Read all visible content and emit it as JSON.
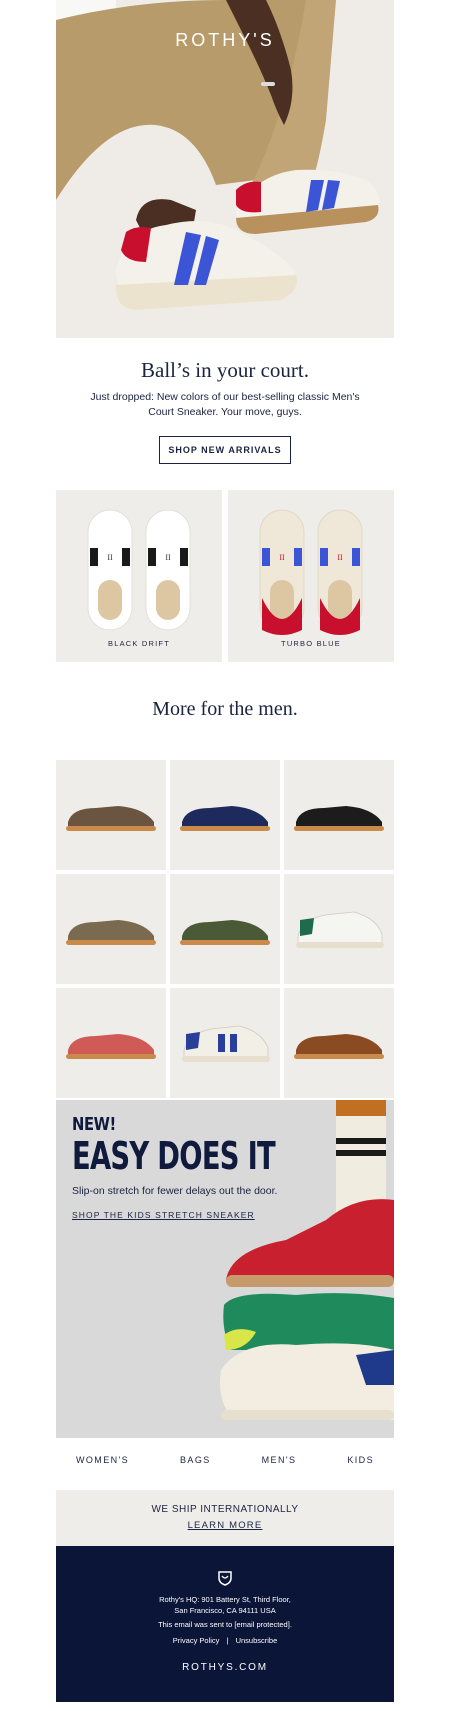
{
  "brand": {
    "logo_text": "ROTHY'S"
  },
  "hero": {
    "headline": "Ball’s in your court.",
    "subtext": "Just dropped: New colors of our best-selling classic Men's Court Sneaker. Your move, guys.",
    "cta_label": "SHOP NEW ARRIVALS"
  },
  "products": [
    {
      "label": "BLACK DRIFT"
    },
    {
      "label": "TURBO BLUE"
    }
  ],
  "more": {
    "title": "More for the men."
  },
  "grid": [
    {
      "name": "brown-driver",
      "color": "#6b5540"
    },
    {
      "name": "navy-driver",
      "color": "#1f2a5c"
    },
    {
      "name": "black-driver",
      "color": "#1c1c1c"
    },
    {
      "name": "camo-brown-driver",
      "color": "#7a6a50"
    },
    {
      "name": "camo-green-driver",
      "color": "#4b5a36"
    },
    {
      "name": "white-green-sneaker",
      "color": "#f5f5f2"
    },
    {
      "name": "red-driver",
      "color": "#d05a55"
    },
    {
      "name": "navy-stripe-sneaker",
      "color": "#f2efe6"
    },
    {
      "name": "cognac-loafer",
      "color": "#8a4a22"
    }
  ],
  "kids": {
    "kicker": "NEW!",
    "title": "EASY DOES IT",
    "subtext": "Slip-on stretch for fewer delays out the door.",
    "link": "SHOP THE KIDS STRETCH SNEAKER"
  },
  "nav": {
    "items": [
      "WOMEN'S",
      "BAGS",
      "MEN'S",
      "KIDS"
    ]
  },
  "shipping": {
    "title": "WE SHIP INTERNATIONALLY",
    "link": "LEARN MORE"
  },
  "footer": {
    "address_line1": "Rothy's HQ: 901 Battery St, Third Floor,",
    "address_line2": "San Francisco, CA 94111 USA",
    "email_note": "This email was sent to [email protected].",
    "privacy": "Privacy Policy",
    "separator": "|",
    "unsubscribe": "Unsubscribe",
    "site": "ROTHYS.COM"
  },
  "colors": {
    "navy": "#0b1538",
    "tile_bg": "#efedea",
    "accent_red": "#c8102e",
    "accent_blue": "#3c55d6"
  }
}
